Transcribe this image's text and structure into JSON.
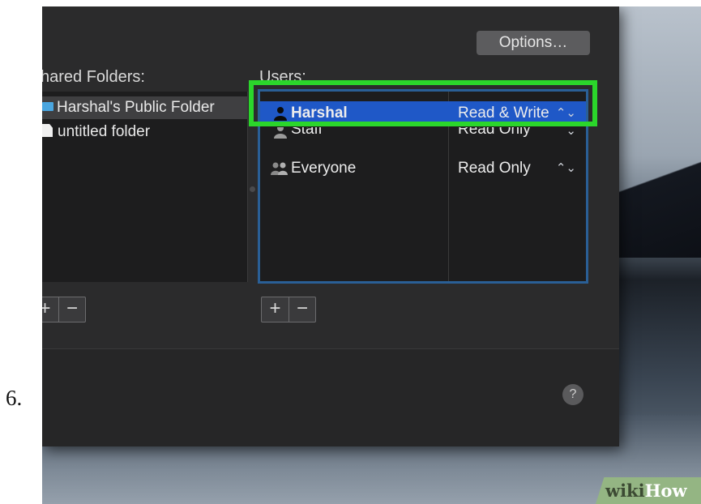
{
  "step": {
    "number": "6."
  },
  "window": {
    "options_button": "Options…",
    "shared_folders_label": "hared Folders:",
    "users_label": "Users:",
    "folders": [
      {
        "name": "Harshal's Public Folder",
        "icon": "blue-folder-icon",
        "selected": true
      },
      {
        "name": "untitled folder",
        "icon": "document-icon",
        "selected": false
      }
    ],
    "users": [
      {
        "name": "Harshal",
        "permission": "Read & Write",
        "stepper": "⌃⌄",
        "icon": "user-icon",
        "selected": true
      },
      {
        "name": "Staff",
        "permission": "Read Only",
        "stepper": "⌄",
        "icon": "user-icon",
        "selected": false
      },
      {
        "name": "Everyone",
        "permission": "Read Only",
        "stepper": "⌃⌄",
        "icon": "group-icon",
        "selected": false
      }
    ],
    "add_symbol": "+",
    "remove_symbol": "−",
    "help_symbol": "?"
  },
  "watermark": {
    "wiki": "wiki",
    "how": "How"
  },
  "colors": {
    "selection_blue": "#1f58c7",
    "highlight_green": "#2bd62b",
    "panel_border": "#2a5f96"
  }
}
